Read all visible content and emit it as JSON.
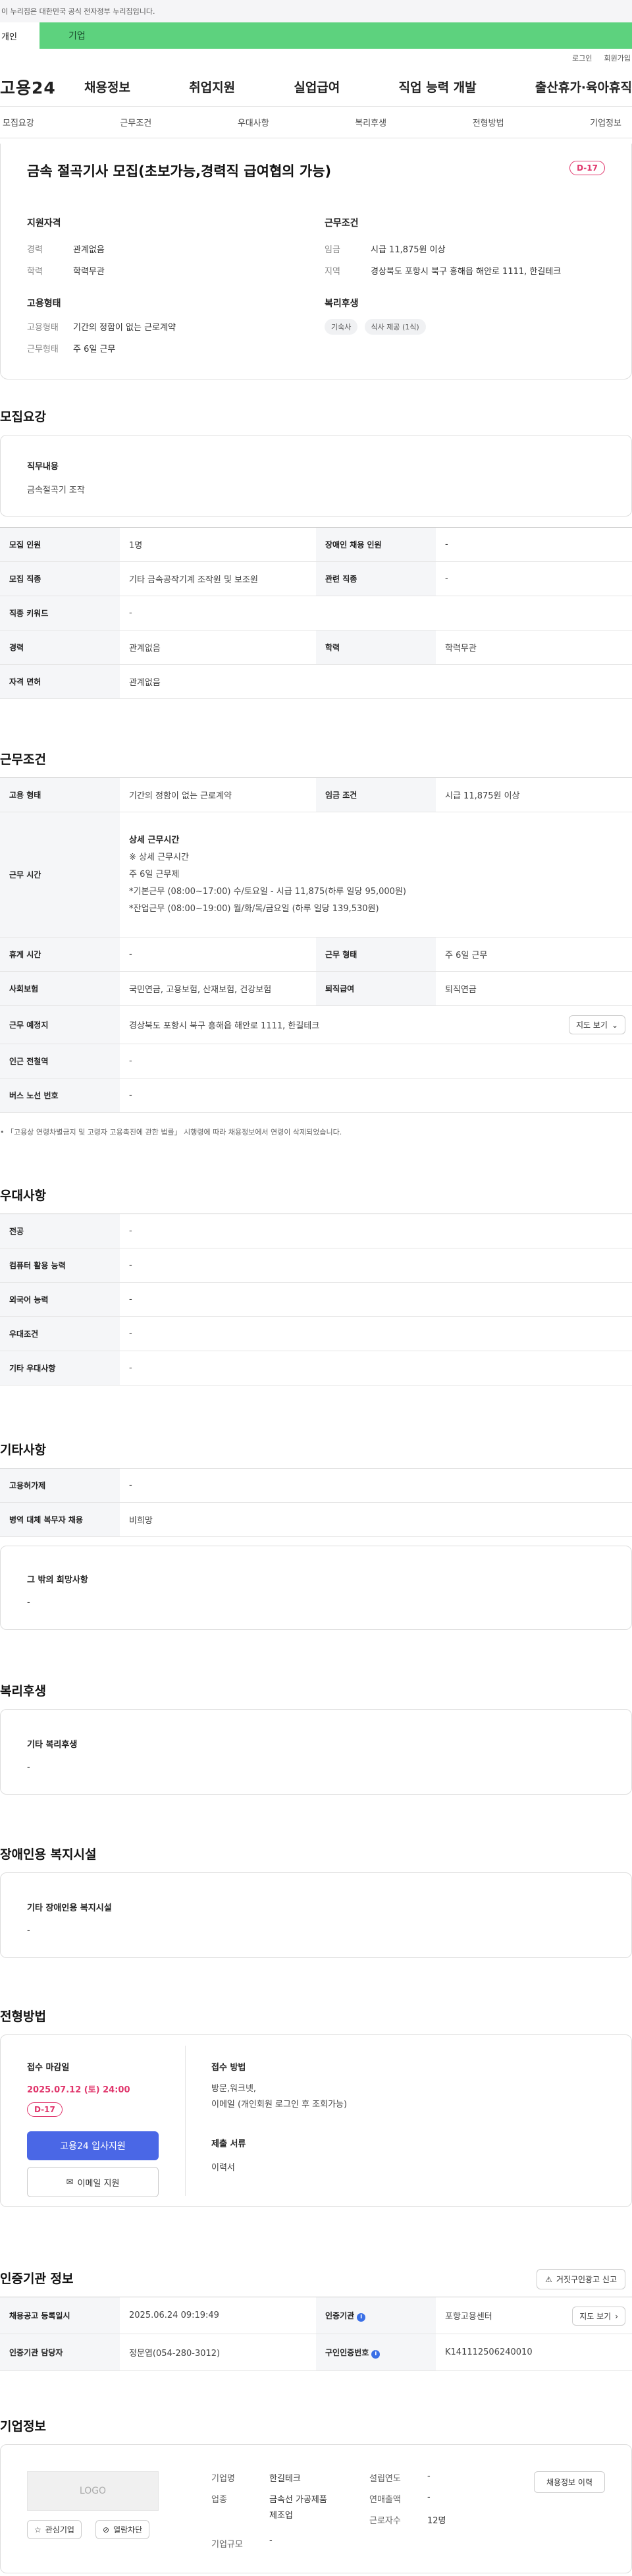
{
  "header": {
    "gov_notice": "이 누리집은 대한민국 공식 전자정부 누리집입니다.",
    "user_tab": "개인",
    "corp_tab": "기업",
    "util_links": [
      "로그인",
      "회원가입"
    ],
    "logo": "고용24",
    "menu": [
      "채용정보",
      "취업지원",
      "실업급여",
      "직업 능력 개발",
      "출산휴가·육아휴직"
    ]
  },
  "subtabs": [
    "모집요강",
    "근무조건",
    "우대사항",
    "복리후생",
    "전형방법",
    "기업정보"
  ],
  "job": {
    "title": "금속 절곡기사 모집(초보가능,경력직 급여협의 가능)",
    "dday": "D-17",
    "qual_title": "지원자격",
    "qual": [
      {
        "k": "경력",
        "v": "관계없음"
      },
      {
        "k": "학력",
        "v": "학력무관"
      }
    ],
    "cond_title": "근무조건",
    "cond": [
      {
        "k": "임금",
        "v": "시급 11,875원 이상"
      },
      {
        "k": "지역",
        "v": "경상북도 포항시 북구 흥해읍 해안로 1111, 한길테크"
      }
    ],
    "emp_title": "고용형태",
    "emp": [
      {
        "k": "고용형태",
        "v": "기간의 정함이 없는 근로계약"
      },
      {
        "k": "근무형태",
        "v": "주 6일 근무"
      }
    ],
    "welfare_title": "복리후생",
    "welfare_chips": [
      "기숙사",
      "식사 제공 (1식)"
    ]
  },
  "recruit": {
    "heading": "모집요강",
    "duty_label": "직무내용",
    "duty_value": "금속절곡기 조작",
    "rows": [
      [
        "모집 인원",
        "1명",
        "장애인 채용 인원",
        "-"
      ],
      [
        "모집 직종",
        "기타 금속공작기계 조작원 및 보조원",
        "관련 직종",
        "-"
      ],
      [
        "직종 키워드",
        "-"
      ],
      [
        "경력",
        "관계없음",
        "학력",
        "학력무관"
      ],
      [
        "자격 면허",
        "관계없음"
      ]
    ]
  },
  "work": {
    "heading": "근무조건",
    "emp_type_label": "고용 형태",
    "emp_type": "기간의 정함이 없는 근로계약",
    "wage_label": "임금 조건",
    "wage": "시급 11,875원 이상",
    "hours_label": "근무 시간",
    "hours_lines": [
      "상세 근무시간",
      "※ 상세 근무시간",
      "주 6일 근무제",
      "*기본근무 (08:00~17:00) 수/토요일 - 시급 11,875(하루 일당 95,000원)",
      "*잔업근무 (08:00~19:00) 월/화/목/금요일 (하루 일당 139,530원)"
    ],
    "rest_label": "휴게 시간",
    "rest": "-",
    "shift_label": "근무 형태",
    "shift": "주 6일 근무",
    "ins_label": "사회보험",
    "ins": "국민연금, 고용보험, 산재보험, 건강보험",
    "retire_label": "퇴직급여",
    "retire": "퇴직연금",
    "place_label": "근무 예정지",
    "place": "경상북도 포항시 북구 흥해읍 해안로 1111, 한길테크",
    "map_btn": "지도 보기",
    "station_label": "인근 전철역",
    "station": "-",
    "bus_label": "버스 노선 번호",
    "bus": "-",
    "note": "「고용상 연령차별금지 및 고령자 고용촉진에 관한 법률」 시행령에 따라 채용정보에서 연령이 삭제되었습니다."
  },
  "pref": {
    "heading": "우대사항",
    "rows": [
      [
        "전공",
        "-"
      ],
      [
        "컴퓨터 활용 능력",
        "-"
      ],
      [
        "외국어 능력",
        "-"
      ],
      [
        "우대조건",
        "-"
      ],
      [
        "기타 우대사항",
        "-"
      ]
    ]
  },
  "etc": {
    "heading": "기타사항",
    "rows": [
      [
        "고용허가제",
        "-"
      ],
      [
        "병역 대체 복무자 채용",
        "비희망"
      ]
    ],
    "other_label": "그 밖의 희망사항",
    "other_value": "-"
  },
  "welfare": {
    "heading": "복리후생",
    "label": "기타 복리후생",
    "value": "-"
  },
  "disabled": {
    "heading": "장애인용 복지시설",
    "label": "기타 장애인용 복지시설",
    "value": "-"
  },
  "screening": {
    "heading": "전형방법",
    "deadline_label": "접수 마감일",
    "deadline": "2025.07.12 (토) 24:00",
    "dday": "D-17",
    "apply_btn": "고용24 입사지원",
    "email_btn": "이메일 지원",
    "method_label": "접수 방법",
    "method_lines": [
      "방문,워크넷,",
      "이메일 (개인회원 로그인 후 조회가능)"
    ],
    "docs_label": "제출 서류",
    "docs": "이력서"
  },
  "agency": {
    "heading": "인증기관 정보",
    "report_btn": "거짓구인광고 신고",
    "reg_label": "채용공고 등록일시",
    "reg": "2025.06.24 09:19:49",
    "agency_label": "인증기관",
    "agency": "포항고용센터",
    "map_btn": "지도 보기",
    "manager_label": "인증기관 담당자",
    "manager": "정문엽(054-280-3012)",
    "num_label": "구인인증번호",
    "num": "K141112506240010"
  },
  "company": {
    "heading": "기업정보",
    "logo": "LOGO",
    "fav_btn": "관심기업",
    "block_btn": "열람차단",
    "name_label": "기업명",
    "name": "한길테크",
    "industry_label": "업종",
    "industry_lines": [
      "금속선 가공제품",
      "제조업"
    ],
    "size_label": "기업규모",
    "size": "-",
    "founded_label": "설립연도",
    "founded": "-",
    "sales_label": "연매출액",
    "sales": "-",
    "staff_label": "근로자수",
    "staff": "12명",
    "history_btn": "채용정보 이력"
  }
}
